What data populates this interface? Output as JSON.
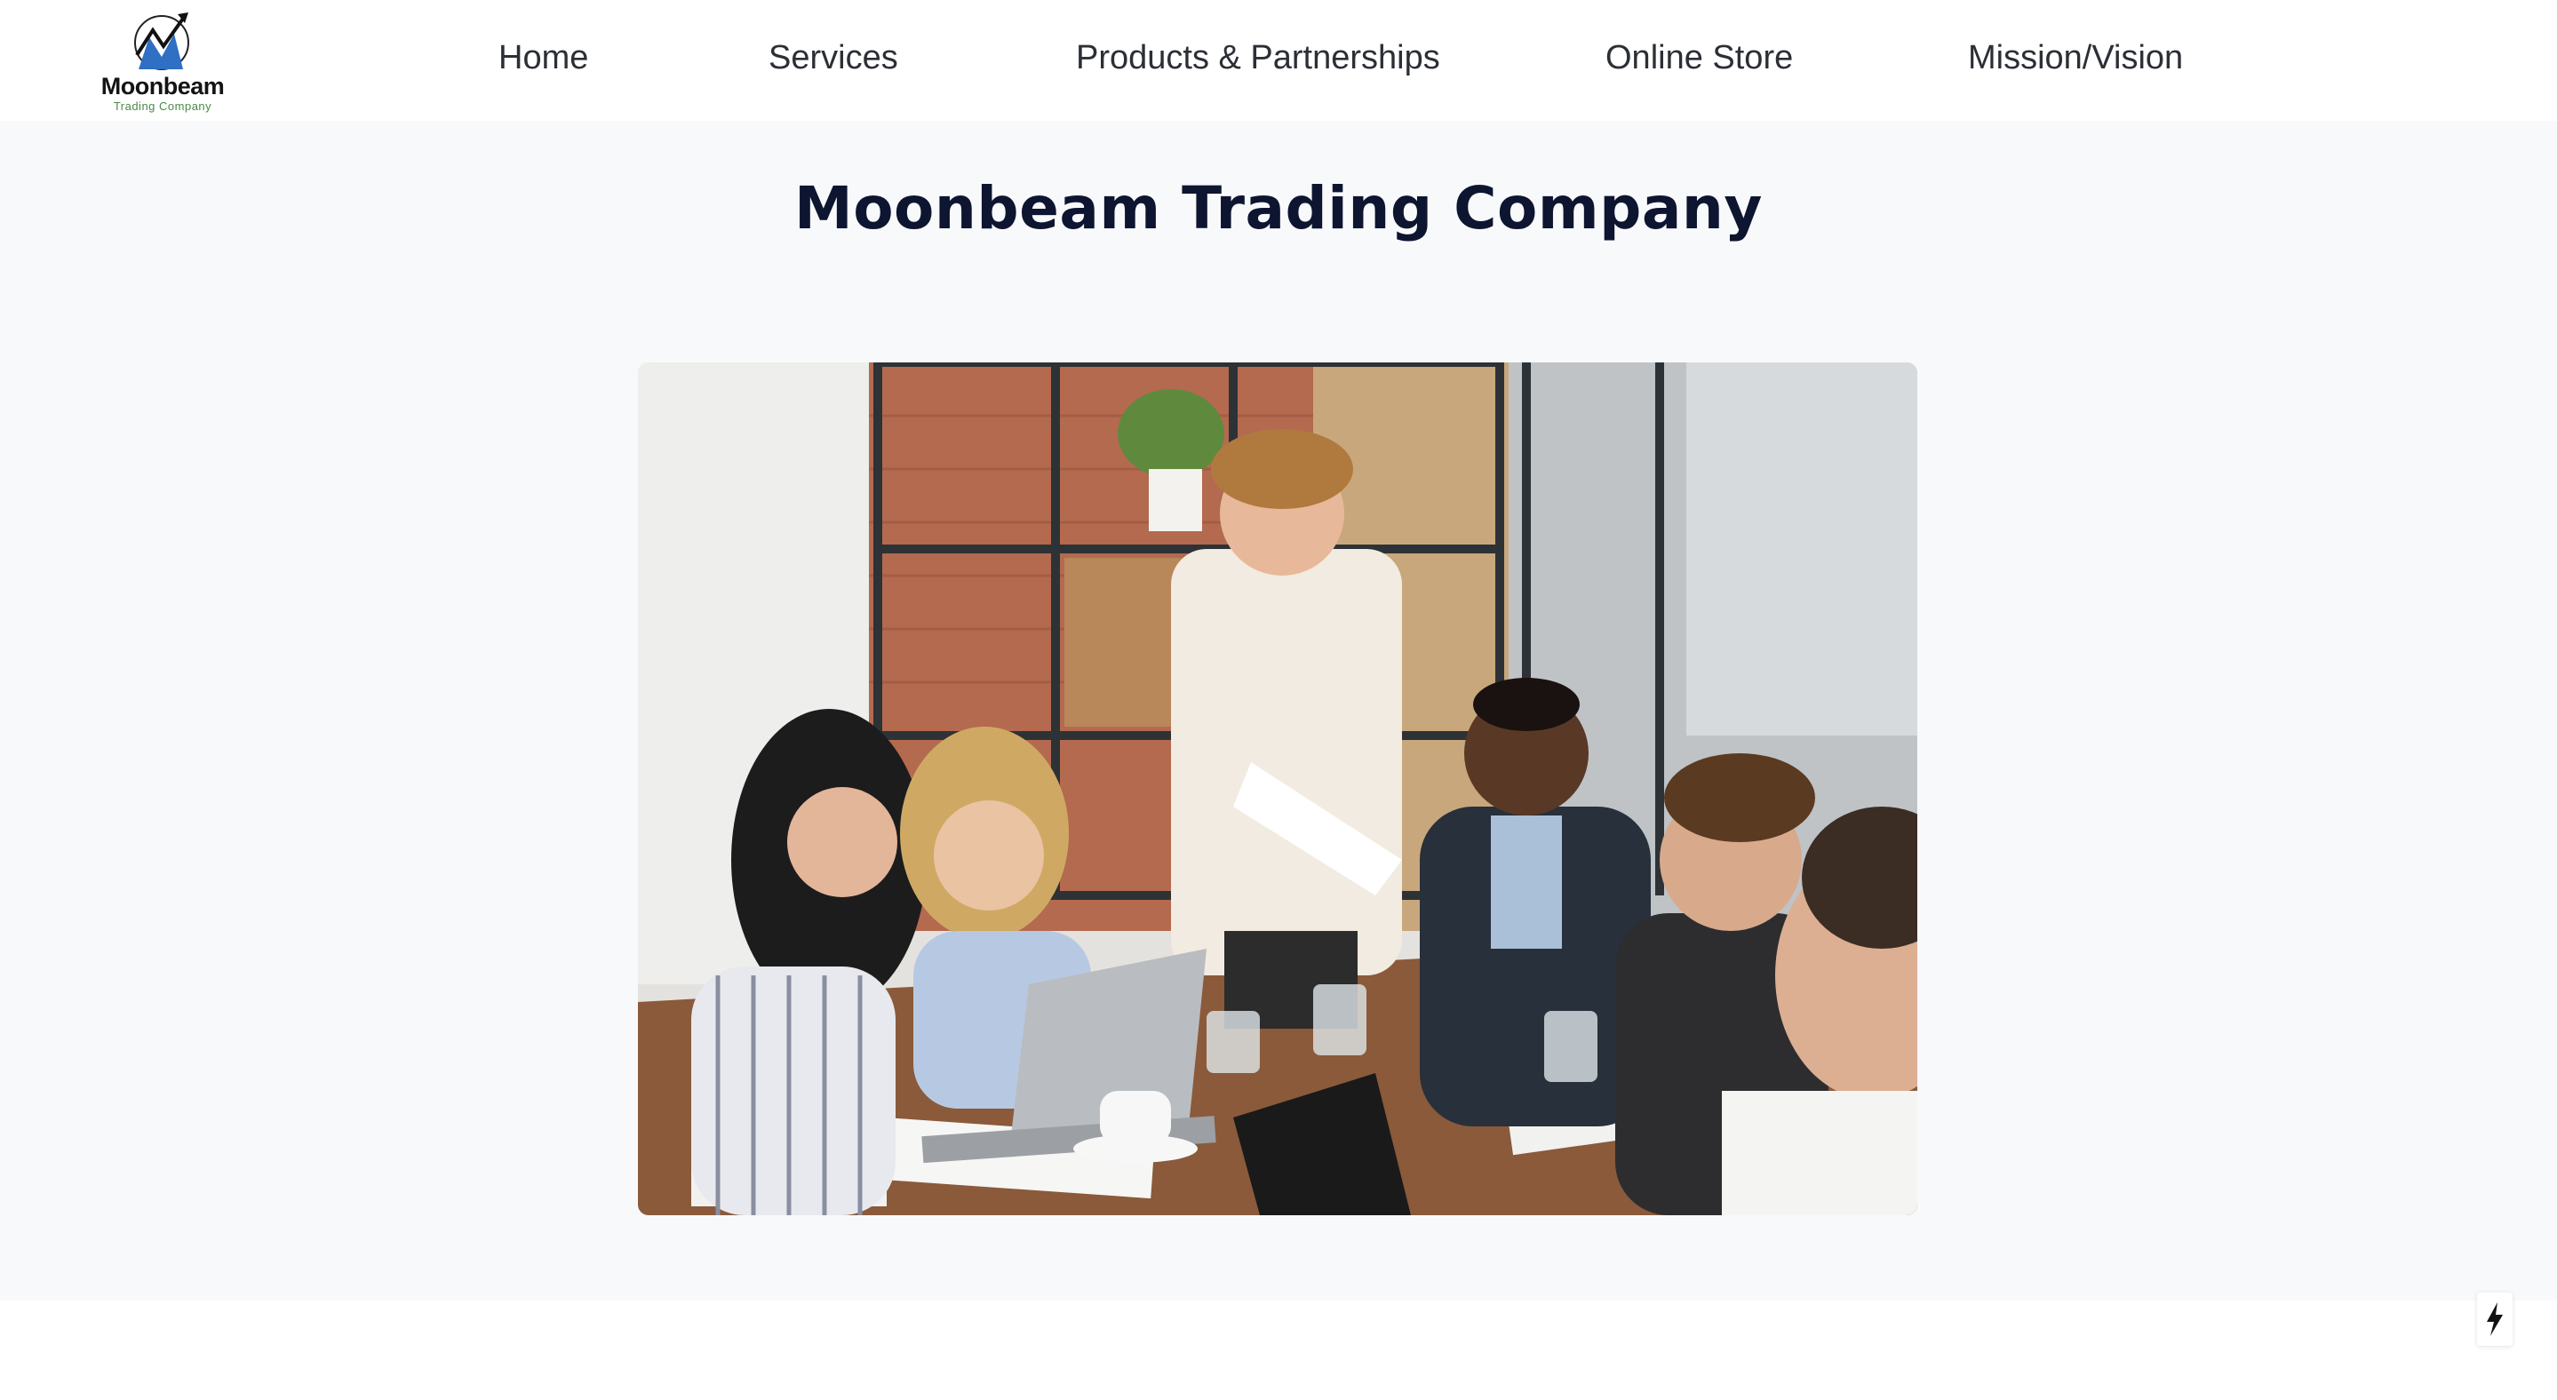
{
  "brand": {
    "logo_word": "Moonbeam",
    "logo_sub": "Trading Company"
  },
  "nav": {
    "items": [
      {
        "label": "Home"
      },
      {
        "label": "Services"
      },
      {
        "label": "Products & Partnerships"
      },
      {
        "label": "Online Store"
      },
      {
        "label": "Mission/Vision"
      }
    ]
  },
  "hero": {
    "title": "Moonbeam Trading Company",
    "image_alt": "Team meeting around a conference table"
  },
  "colors": {
    "title": "#0d1530",
    "nav_text": "#2b2f36",
    "logo_accent": "#2f6fc4"
  },
  "icons": {
    "logo": "moonbeam-logo-icon",
    "badge": "lightning-bolt-icon"
  }
}
